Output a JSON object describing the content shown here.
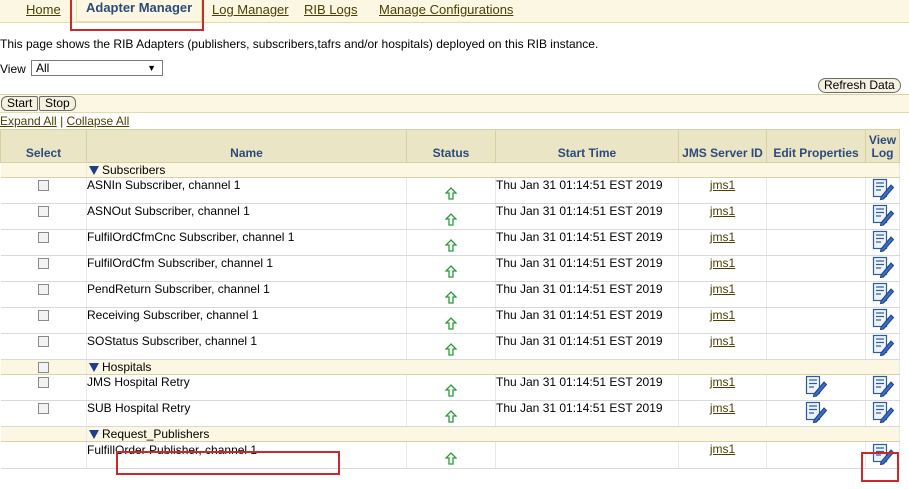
{
  "nav": {
    "tabs": [
      {
        "label": "Home"
      },
      {
        "label": "Adapter Manager"
      },
      {
        "label": "Log Manager"
      },
      {
        "label": "RIB Logs"
      },
      {
        "label": "Manage Configurations"
      }
    ]
  },
  "intro_text": "This page shows the RIB Adapters (publishers, subscribers,tafrs and/or hospitals) deployed on this RIB instance.",
  "view": {
    "label": "View",
    "selected": "All"
  },
  "refresh_button": "Refresh Data",
  "start_button": "Start",
  "stop_button": "Stop",
  "expand_all": "Expand All",
  "collapse_all": "Collapse All",
  "separator": "|",
  "table": {
    "headers": {
      "select": "Select",
      "name": "Name",
      "status": "Status",
      "start_time": "Start Time",
      "jms": "JMS Server ID",
      "edit": "Edit Properties",
      "view_log": "View Log"
    },
    "groups": [
      {
        "label": "Subscribers",
        "rows": [
          {
            "name": "ASNIn Subscriber, channel 1",
            "start_time": "Thu Jan 31 01:14:51 EST 2019",
            "jms": "jms1"
          },
          {
            "name": "ASNOut Subscriber, channel 1",
            "start_time": "Thu Jan 31 01:14:51 EST 2019",
            "jms": "jms1"
          },
          {
            "name": "FulfilOrdCfmCnc Subscriber, channel 1",
            "start_time": "Thu Jan 31 01:14:51 EST 2019",
            "jms": "jms1"
          },
          {
            "name": "FulfilOrdCfm Subscriber, channel 1",
            "start_time": "Thu Jan 31 01:14:51 EST 2019",
            "jms": "jms1"
          },
          {
            "name": "PendReturn Subscriber, channel 1",
            "start_time": "Thu Jan 31 01:14:51 EST 2019",
            "jms": "jms1"
          },
          {
            "name": "Receiving Subscriber, channel 1",
            "start_time": "Thu Jan 31 01:14:51 EST 2019",
            "jms": "jms1"
          },
          {
            "name": "SOStatus Subscriber, channel 1",
            "start_time": "Thu Jan 31 01:14:51 EST 2019",
            "jms": "jms1"
          }
        ]
      },
      {
        "label": "Hospitals",
        "rows": [
          {
            "name": "JMS Hospital Retry",
            "start_time": "Thu Jan 31 01:14:51 EST 2019",
            "jms": "jms1"
          },
          {
            "name": "SUB Hospital Retry",
            "start_time": "Thu Jan 31 01:14:51 EST 2019",
            "jms": "jms1"
          }
        ]
      },
      {
        "label": "Request_Publishers",
        "rows": [
          {
            "name": "FulfillOrder Publisher, channel 1",
            "start_time": "",
            "jms": "jms1"
          }
        ]
      }
    ]
  },
  "icons": {
    "status": "up-arrow-icon",
    "view_log": "view-log-icon",
    "edit": "edit-properties-icon",
    "group_toggle": "triangle-down-icon"
  },
  "colors": {
    "header_text": "#2d4a7a",
    "header_bg": "#eae5c5",
    "band_bg": "#fbf7e2",
    "link": "#4a3f00",
    "status_green": "#2a9a3a",
    "highlight": "#cc2a2a"
  }
}
